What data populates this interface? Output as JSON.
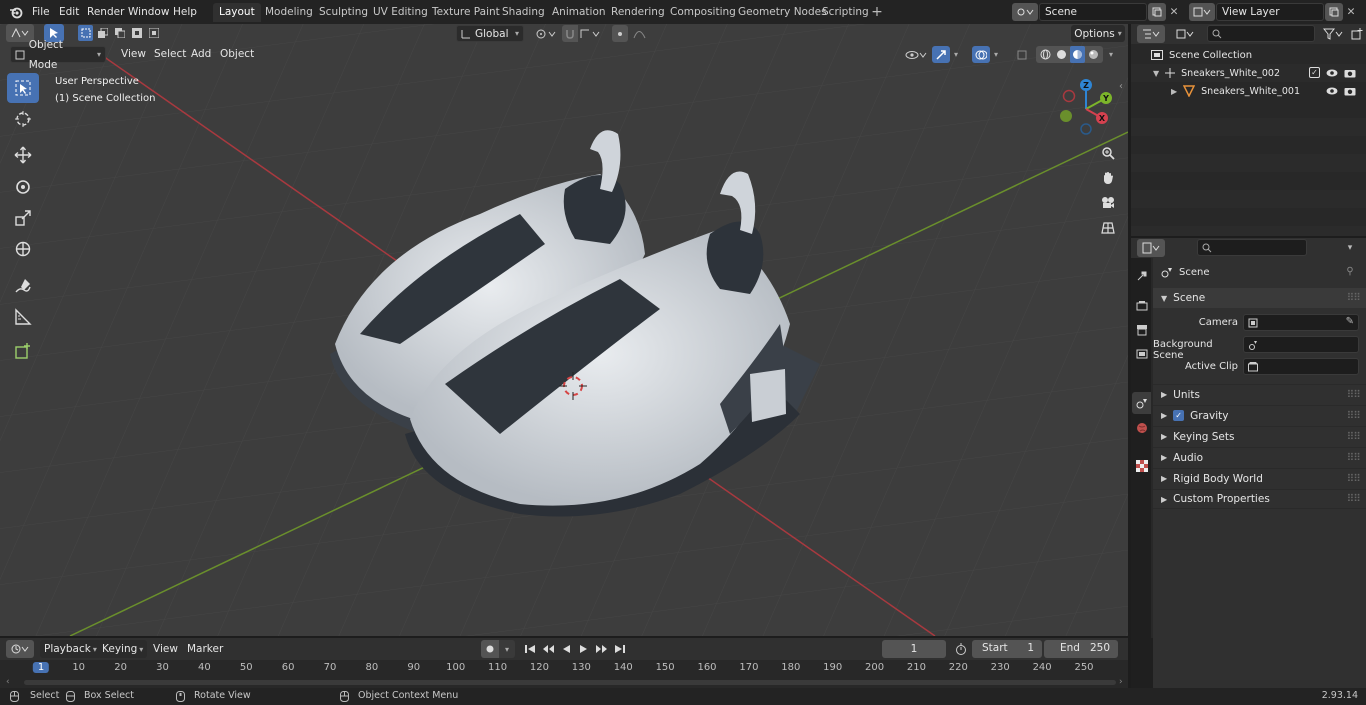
{
  "menus": [
    "File",
    "Edit",
    "Render",
    "Window",
    "Help"
  ],
  "workspaces": [
    "Layout",
    "Modeling",
    "Sculpting",
    "UV Editing",
    "Texture Paint",
    "Shading",
    "Animation",
    "Rendering",
    "Compositing",
    "Geometry Nodes",
    "Scripting"
  ],
  "scene_name": "Scene",
  "view_layer": "View Layer",
  "header": {
    "mode": "Object Mode",
    "menus": [
      "View",
      "Select",
      "Add",
      "Object"
    ],
    "transform_orientation": "Global",
    "options": "Options"
  },
  "viewport": {
    "perspective": "User Perspective",
    "collection": "(1) Scene Collection",
    "axis": {
      "x": "X",
      "y": "Y",
      "z": "Z"
    }
  },
  "outliner": {
    "root": "Scene Collection",
    "items": [
      "Sneakers_White_002",
      "Sneakers_White_001"
    ]
  },
  "properties": {
    "breadcrumb": "Scene",
    "section": "Scene",
    "fields": [
      {
        "label": "Camera"
      },
      {
        "label": "Background Scene"
      },
      {
        "label": "Active Clip"
      }
    ],
    "panels": [
      "Units",
      "Gravity",
      "Keying Sets",
      "Audio",
      "Rigid Body World",
      "Custom Properties"
    ],
    "gravity_checked": true
  },
  "timeline": {
    "menus": [
      "Playback",
      "Keying",
      "View",
      "Marker"
    ],
    "current_frame": "1",
    "start_label": "Start",
    "start": "1",
    "end_label": "End",
    "end": "250",
    "ruler": [
      "1",
      "10",
      "20",
      "30",
      "40",
      "50",
      "60",
      "70",
      "80",
      "90",
      "100",
      "110",
      "120",
      "130",
      "140",
      "150",
      "160",
      "170",
      "180",
      "190",
      "200",
      "210",
      "220",
      "230",
      "240",
      "250"
    ]
  },
  "status": {
    "select": "Select",
    "box_select": "Box Select",
    "rotate": "Rotate View",
    "context_menu": "Object Context Menu",
    "version": "2.93.14"
  },
  "colors": {
    "accent": "#4772b3",
    "x_axis": "#d4414f",
    "y_axis": "#7cb52a",
    "z_axis": "#2e85d4",
    "object_orange": "#e8923a"
  }
}
